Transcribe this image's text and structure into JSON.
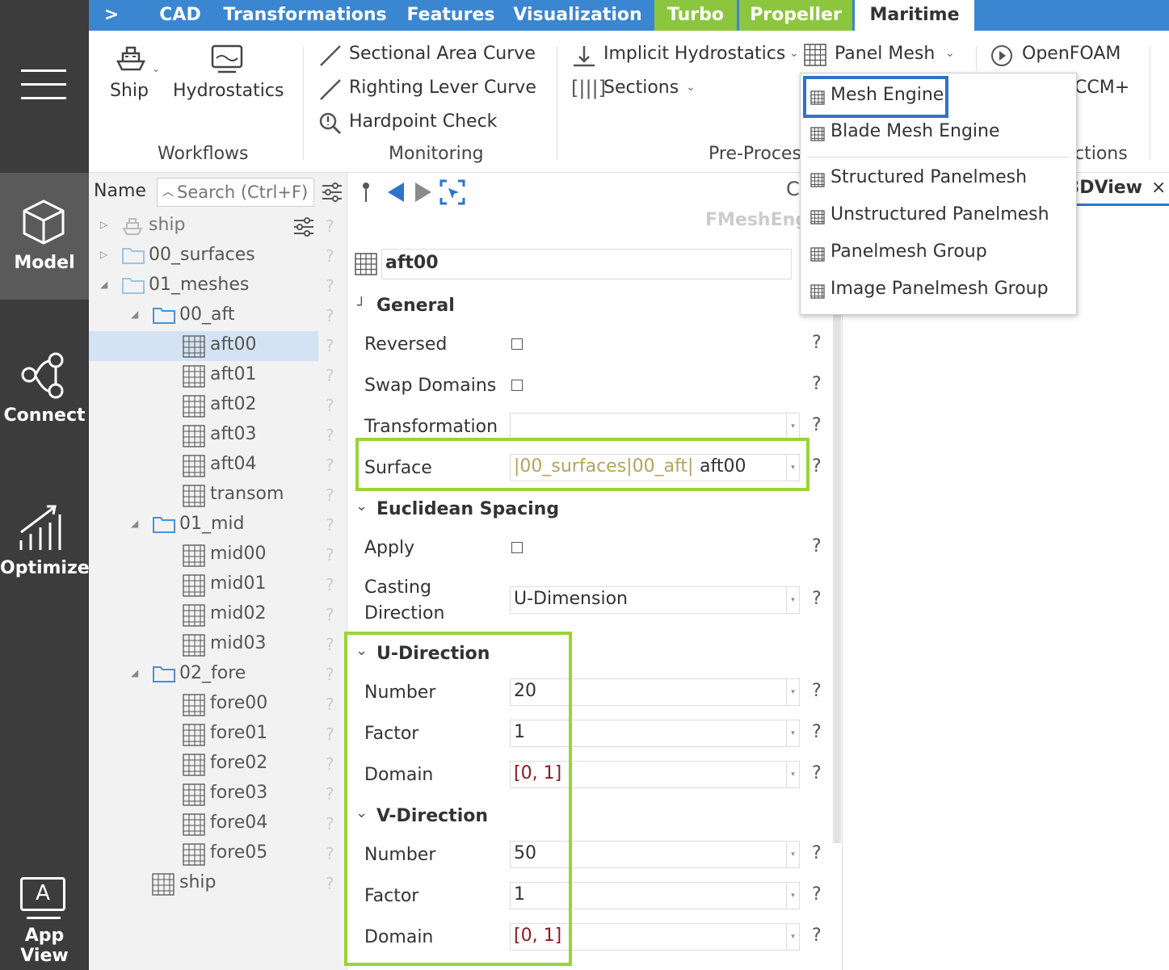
{
  "leftbar": {
    "model_label": "Model",
    "connect_label": "Connect",
    "optimize_label": "Optimize",
    "appview_label": "App View",
    "appview_glyph": "A"
  },
  "tabs": {
    "expand": ">",
    "items": [
      "CAD",
      "Transformations",
      "Features",
      "Visualization",
      "Turbo",
      "Propeller",
      "Maritime"
    ]
  },
  "ribbon": {
    "ship": "Ship",
    "hydrostatics": "Hydrostatics",
    "sectional_area": "Sectional Area Curve",
    "righting_lever": "Righting Lever Curve",
    "hardpoint": "Hardpoint Check",
    "implicit_hydro": "Implicit Hydrostatics",
    "sections": "Sections",
    "panel_mesh": "Panel Mesh",
    "openfoam": "OpenFOAM",
    "ccm_partial": "CCM+",
    "groups": {
      "workflows": "Workflows",
      "monitoring": "Monitoring",
      "preprocessing_partial": "Pre-Proces",
      "connections_partial": "ctions"
    }
  },
  "menu": {
    "items": [
      "Mesh Engine",
      "Blade Mesh Engine",
      "Structured Panelmesh",
      "Unstructured Panelmesh",
      "Panelmesh Group",
      "Image Panelmesh Group"
    ]
  },
  "tree": {
    "name_label": "Name",
    "search_placeholder": "Search (Ctrl+F)",
    "help": "?",
    "items": [
      {
        "name": "ship"
      },
      {
        "name": "00_surfaces"
      },
      {
        "name": "01_meshes"
      },
      {
        "name": "00_aft"
      },
      {
        "name": "aft00"
      },
      {
        "name": "aft01"
      },
      {
        "name": "aft02"
      },
      {
        "name": "aft03"
      },
      {
        "name": "aft04"
      },
      {
        "name": "transom"
      },
      {
        "name": "01_mid"
      },
      {
        "name": "mid00"
      },
      {
        "name": "mid01"
      },
      {
        "name": "mid02"
      },
      {
        "name": "mid03"
      },
      {
        "name": "02_fore"
      },
      {
        "name": "fore00"
      },
      {
        "name": "fore01"
      },
      {
        "name": "fore02"
      },
      {
        "name": "fore03"
      },
      {
        "name": "fore04"
      },
      {
        "name": "fore05"
      },
      {
        "name": "ship"
      }
    ]
  },
  "props": {
    "type_label": "FMeshEng",
    "object_name": "aft00",
    "general": "General",
    "reversed": "Reversed",
    "swap_domains": "Swap Domains",
    "transformation": "Transformation",
    "surface": "Surface",
    "surface_path_a": "|00_surfaces|00_aft|",
    "surface_path_b": "aft00",
    "euclidean": "Euclidean Spacing",
    "apply": "Apply",
    "casting_1": "Casting",
    "casting_2": "Direction",
    "casting_value": "U-Dimension",
    "u_direction": "U-Direction",
    "v_direction": "V-Direction",
    "number": "Number",
    "factor": "Factor",
    "domain": "Domain",
    "u_number": "20",
    "u_factor": "1",
    "u_domain": "[0, 1]",
    "v_number": "50",
    "v_factor": "1",
    "v_domain": "[0, 1]",
    "help": "?"
  },
  "view": {
    "tab_partial": "3DView",
    "close": "×"
  },
  "colors": {
    "tab_blue": "#3a86d0",
    "tab_green": "#8cc63e",
    "highlight_green": "#9ad33a",
    "highlight_blue": "#2f73c9",
    "sidebar": "#3c3c3c",
    "domain_red": "#8b1a1a"
  }
}
